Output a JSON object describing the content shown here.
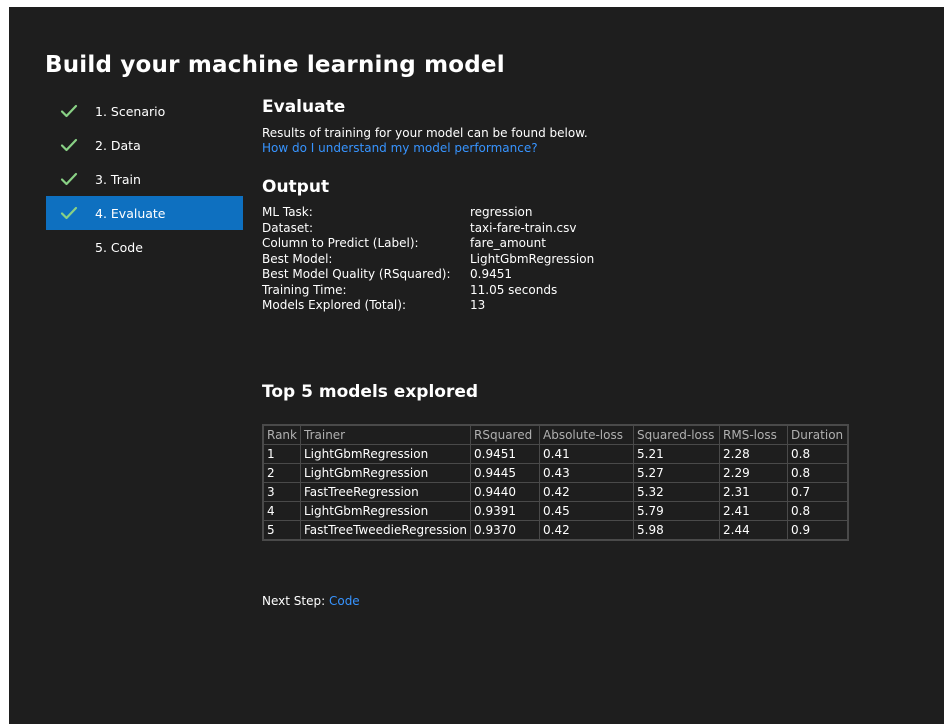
{
  "page": {
    "title": "Build your machine learning model"
  },
  "steps": [
    {
      "label": "1. Scenario",
      "completed": true,
      "active": false
    },
    {
      "label": "2. Data",
      "completed": true,
      "active": false
    },
    {
      "label": "3. Train",
      "completed": true,
      "active": false
    },
    {
      "label": "4. Evaluate",
      "completed": true,
      "active": true
    },
    {
      "label": "5. Code",
      "completed": false,
      "active": false
    }
  ],
  "evaluate": {
    "heading": "Evaluate",
    "description": "Results of training for your model can be found below.",
    "help_link": "How do I understand my model performance?"
  },
  "output": {
    "heading": "Output",
    "rows": [
      {
        "key": "ML Task:",
        "value": "regression"
      },
      {
        "key": "Dataset:",
        "value": "taxi-fare-train.csv"
      },
      {
        "key": "Column to Predict (Label):",
        "value": "fare_amount"
      },
      {
        "key": "Best Model:",
        "value": "LightGbmRegression"
      },
      {
        "key": "Best Model Quality (RSquared):",
        "value": "0.9451"
      },
      {
        "key": "Training Time:",
        "value": "11.05 seconds"
      },
      {
        "key": "Models Explored (Total):",
        "value": "13"
      }
    ]
  },
  "top_models": {
    "heading": "Top 5 models explored",
    "columns": [
      "Rank",
      "Trainer",
      "RSquared",
      "Absolute-loss",
      "Squared-loss",
      "RMS-loss",
      "Duration"
    ],
    "rows": [
      [
        "1",
        "LightGbmRegression",
        "0.9451",
        "0.41",
        "5.21",
        "2.28",
        "0.8"
      ],
      [
        "2",
        "LightGbmRegression",
        "0.9445",
        "0.43",
        "5.27",
        "2.29",
        "0.8"
      ],
      [
        "3",
        "FastTreeRegression",
        "0.9440",
        "0.42",
        "5.32",
        "2.31",
        "0.7"
      ],
      [
        "4",
        "LightGbmRegression",
        "0.9391",
        "0.45",
        "5.79",
        "2.41",
        "0.8"
      ],
      [
        "5",
        "FastTreeTweedieRegression",
        "0.9370",
        "0.42",
        "5.98",
        "2.44",
        "0.9"
      ]
    ]
  },
  "next_step": {
    "label": "Next Step:",
    "link": "Code"
  },
  "colors": {
    "background": "#1e1e1e",
    "active_step": "#0e70c0",
    "link": "#3794ff",
    "check": "#89d185"
  }
}
